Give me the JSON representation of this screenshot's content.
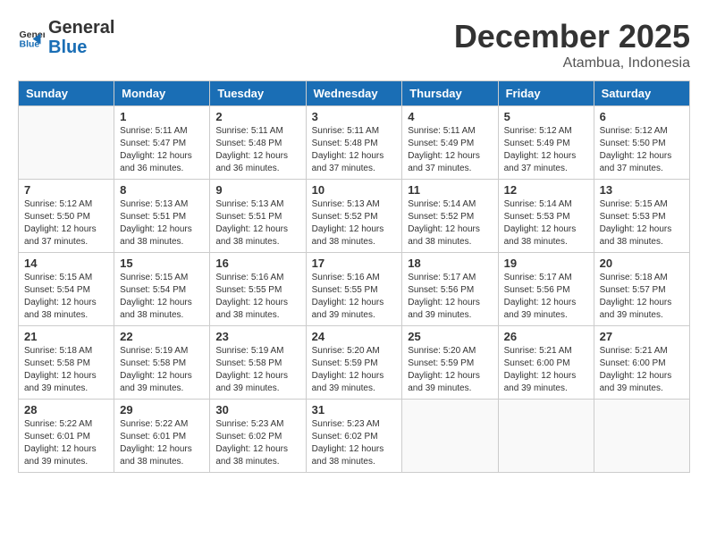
{
  "header": {
    "logo_general": "General",
    "logo_blue": "Blue",
    "month": "December 2025",
    "location": "Atambua, Indonesia"
  },
  "weekdays": [
    "Sunday",
    "Monday",
    "Tuesday",
    "Wednesday",
    "Thursday",
    "Friday",
    "Saturday"
  ],
  "weeks": [
    [
      {
        "day": "",
        "sunrise": "",
        "sunset": "",
        "daylight": ""
      },
      {
        "day": "1",
        "sunrise": "Sunrise: 5:11 AM",
        "sunset": "Sunset: 5:47 PM",
        "daylight": "Daylight: 12 hours and 36 minutes."
      },
      {
        "day": "2",
        "sunrise": "Sunrise: 5:11 AM",
        "sunset": "Sunset: 5:48 PM",
        "daylight": "Daylight: 12 hours and 36 minutes."
      },
      {
        "day": "3",
        "sunrise": "Sunrise: 5:11 AM",
        "sunset": "Sunset: 5:48 PM",
        "daylight": "Daylight: 12 hours and 37 minutes."
      },
      {
        "day": "4",
        "sunrise": "Sunrise: 5:11 AM",
        "sunset": "Sunset: 5:49 PM",
        "daylight": "Daylight: 12 hours and 37 minutes."
      },
      {
        "day": "5",
        "sunrise": "Sunrise: 5:12 AM",
        "sunset": "Sunset: 5:49 PM",
        "daylight": "Daylight: 12 hours and 37 minutes."
      },
      {
        "day": "6",
        "sunrise": "Sunrise: 5:12 AM",
        "sunset": "Sunset: 5:50 PM",
        "daylight": "Daylight: 12 hours and 37 minutes."
      }
    ],
    [
      {
        "day": "7",
        "sunrise": "Sunrise: 5:12 AM",
        "sunset": "Sunset: 5:50 PM",
        "daylight": "Daylight: 12 hours and 37 minutes."
      },
      {
        "day": "8",
        "sunrise": "Sunrise: 5:13 AM",
        "sunset": "Sunset: 5:51 PM",
        "daylight": "Daylight: 12 hours and 38 minutes."
      },
      {
        "day": "9",
        "sunrise": "Sunrise: 5:13 AM",
        "sunset": "Sunset: 5:51 PM",
        "daylight": "Daylight: 12 hours and 38 minutes."
      },
      {
        "day": "10",
        "sunrise": "Sunrise: 5:13 AM",
        "sunset": "Sunset: 5:52 PM",
        "daylight": "Daylight: 12 hours and 38 minutes."
      },
      {
        "day": "11",
        "sunrise": "Sunrise: 5:14 AM",
        "sunset": "Sunset: 5:52 PM",
        "daylight": "Daylight: 12 hours and 38 minutes."
      },
      {
        "day": "12",
        "sunrise": "Sunrise: 5:14 AM",
        "sunset": "Sunset: 5:53 PM",
        "daylight": "Daylight: 12 hours and 38 minutes."
      },
      {
        "day": "13",
        "sunrise": "Sunrise: 5:15 AM",
        "sunset": "Sunset: 5:53 PM",
        "daylight": "Daylight: 12 hours and 38 minutes."
      }
    ],
    [
      {
        "day": "14",
        "sunrise": "Sunrise: 5:15 AM",
        "sunset": "Sunset: 5:54 PM",
        "daylight": "Daylight: 12 hours and 38 minutes."
      },
      {
        "day": "15",
        "sunrise": "Sunrise: 5:15 AM",
        "sunset": "Sunset: 5:54 PM",
        "daylight": "Daylight: 12 hours and 38 minutes."
      },
      {
        "day": "16",
        "sunrise": "Sunrise: 5:16 AM",
        "sunset": "Sunset: 5:55 PM",
        "daylight": "Daylight: 12 hours and 38 minutes."
      },
      {
        "day": "17",
        "sunrise": "Sunrise: 5:16 AM",
        "sunset": "Sunset: 5:55 PM",
        "daylight": "Daylight: 12 hours and 39 minutes."
      },
      {
        "day": "18",
        "sunrise": "Sunrise: 5:17 AM",
        "sunset": "Sunset: 5:56 PM",
        "daylight": "Daylight: 12 hours and 39 minutes."
      },
      {
        "day": "19",
        "sunrise": "Sunrise: 5:17 AM",
        "sunset": "Sunset: 5:56 PM",
        "daylight": "Daylight: 12 hours and 39 minutes."
      },
      {
        "day": "20",
        "sunrise": "Sunrise: 5:18 AM",
        "sunset": "Sunset: 5:57 PM",
        "daylight": "Daylight: 12 hours and 39 minutes."
      }
    ],
    [
      {
        "day": "21",
        "sunrise": "Sunrise: 5:18 AM",
        "sunset": "Sunset: 5:58 PM",
        "daylight": "Daylight: 12 hours and 39 minutes."
      },
      {
        "day": "22",
        "sunrise": "Sunrise: 5:19 AM",
        "sunset": "Sunset: 5:58 PM",
        "daylight": "Daylight: 12 hours and 39 minutes."
      },
      {
        "day": "23",
        "sunrise": "Sunrise: 5:19 AM",
        "sunset": "Sunset: 5:58 PM",
        "daylight": "Daylight: 12 hours and 39 minutes."
      },
      {
        "day": "24",
        "sunrise": "Sunrise: 5:20 AM",
        "sunset": "Sunset: 5:59 PM",
        "daylight": "Daylight: 12 hours and 39 minutes."
      },
      {
        "day": "25",
        "sunrise": "Sunrise: 5:20 AM",
        "sunset": "Sunset: 5:59 PM",
        "daylight": "Daylight: 12 hours and 39 minutes."
      },
      {
        "day": "26",
        "sunrise": "Sunrise: 5:21 AM",
        "sunset": "Sunset: 6:00 PM",
        "daylight": "Daylight: 12 hours and 39 minutes."
      },
      {
        "day": "27",
        "sunrise": "Sunrise: 5:21 AM",
        "sunset": "Sunset: 6:00 PM",
        "daylight": "Daylight: 12 hours and 39 minutes."
      }
    ],
    [
      {
        "day": "28",
        "sunrise": "Sunrise: 5:22 AM",
        "sunset": "Sunset: 6:01 PM",
        "daylight": "Daylight: 12 hours and 39 minutes."
      },
      {
        "day": "29",
        "sunrise": "Sunrise: 5:22 AM",
        "sunset": "Sunset: 6:01 PM",
        "daylight": "Daylight: 12 hours and 38 minutes."
      },
      {
        "day": "30",
        "sunrise": "Sunrise: 5:23 AM",
        "sunset": "Sunset: 6:02 PM",
        "daylight": "Daylight: 12 hours and 38 minutes."
      },
      {
        "day": "31",
        "sunrise": "Sunrise: 5:23 AM",
        "sunset": "Sunset: 6:02 PM",
        "daylight": "Daylight: 12 hours and 38 minutes."
      },
      {
        "day": "",
        "sunrise": "",
        "sunset": "",
        "daylight": ""
      },
      {
        "day": "",
        "sunrise": "",
        "sunset": "",
        "daylight": ""
      },
      {
        "day": "",
        "sunrise": "",
        "sunset": "",
        "daylight": ""
      }
    ]
  ]
}
